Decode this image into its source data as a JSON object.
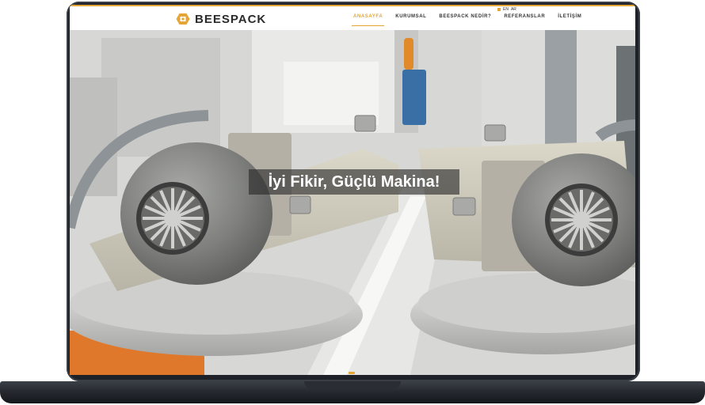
{
  "site": {
    "brand": "BEESPACK",
    "accent_color": "#e3a637",
    "logo_icon": "hexagon-logo-icon"
  },
  "nav": {
    "items": [
      {
        "label": "ANASAYFA",
        "active": true
      },
      {
        "label": "KURUMSAL",
        "active": false
      },
      {
        "label": "BEESPACK NEDİR?",
        "active": false
      },
      {
        "label": "REFERANSLAR",
        "active": false
      },
      {
        "label": "İLETİŞİM",
        "active": false
      }
    ]
  },
  "languages": [
    "TR",
    "EN",
    "AR"
  ],
  "hero": {
    "title": "İyi Fikir, Güçlü Makina!"
  }
}
